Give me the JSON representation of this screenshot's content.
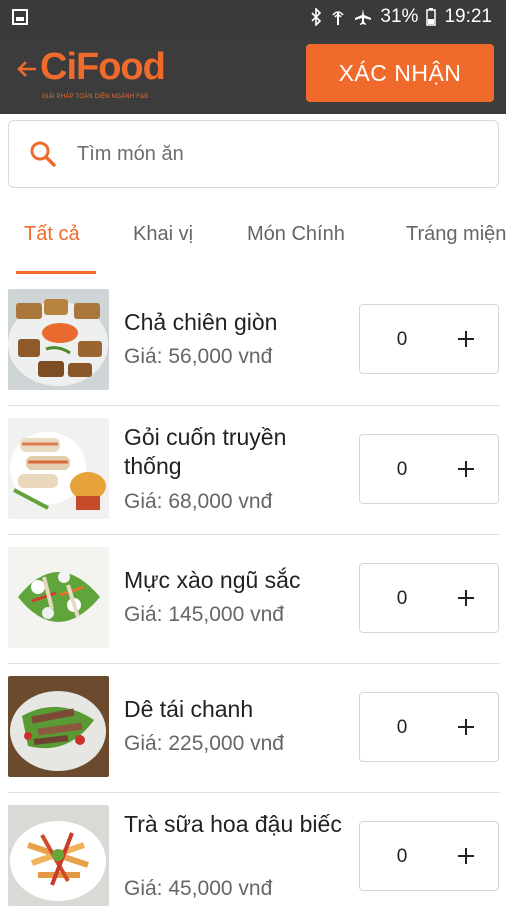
{
  "status_bar": {
    "battery_percent": "31%",
    "time": "19:21",
    "icons": [
      "gallery-icon",
      "bluetooth-icon",
      "signal-icon",
      "airplane-mode-icon",
      "battery-icon"
    ]
  },
  "app_bar": {
    "back_icon": "back-arrow-icon",
    "logo_text": "CiFood",
    "logo_subtitle": "GIẢI PHÁP TOÀN DIỆN NGÀNH F&B",
    "confirm_label": "XÁC NHẬN"
  },
  "search": {
    "icon": "search-icon",
    "placeholder": "Tìm món ăn",
    "value": ""
  },
  "tabs": [
    {
      "label": "Tất cả",
      "active": true
    },
    {
      "label": "Khai vị",
      "active": false
    },
    {
      "label": "Món Chính",
      "active": false
    },
    {
      "label": "Tráng miệng",
      "active": false
    }
  ],
  "items": [
    {
      "name": "Chả chiên giòn",
      "price": "Giá: 56,000 vnđ",
      "qty": "0"
    },
    {
      "name": "Gỏi cuốn truyền thống",
      "price": "Giá: 68,000 vnđ",
      "qty": "0"
    },
    {
      "name": "Mực xào ngũ sắc",
      "price": "Giá: 145,000 vnđ",
      "qty": "0"
    },
    {
      "name": "Dê tái chanh",
      "price": "Giá: 225,000 vnđ",
      "qty": "0"
    },
    {
      "name": "Trà sữa hoa đậu biếc",
      "price": "Giá: 45,000 vnđ",
      "qty": "0"
    }
  ],
  "colors": {
    "accent": "#ef6a2b",
    "app_bar": "#3c3c3c",
    "status_bar": "#3a3a3a"
  }
}
